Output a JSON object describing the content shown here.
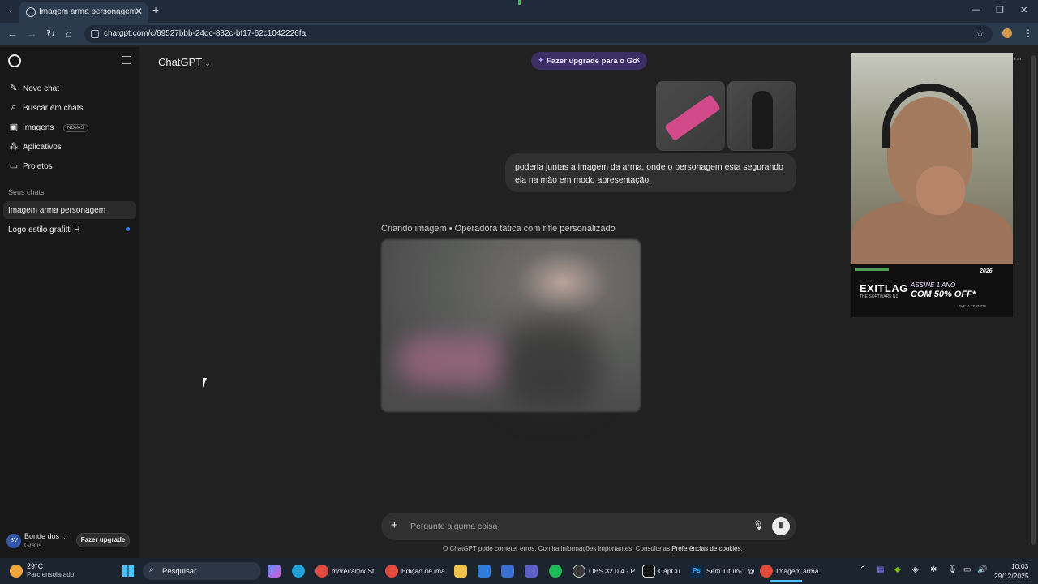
{
  "browser": {
    "tab_title": "Imagem arma personagem",
    "tab_close": "✕",
    "new_tab": "+",
    "tab_menu": "⌄",
    "url": "chatgpt.com/c/69527bbb-24dc-832c-bf17-62c1042226fa",
    "back": "←",
    "forward": "→",
    "reload": "↻",
    "home": "⌂",
    "star": "☆",
    "menu": "⋮",
    "minimize": "—",
    "maximize": "❐",
    "close": "✕"
  },
  "sidebar": {
    "nav": [
      {
        "label": "Novo chat",
        "icon": "✎",
        "icon_name": "new-chat-icon"
      },
      {
        "label": "Buscar em chats",
        "icon": "⌕",
        "icon_name": "search-icon"
      },
      {
        "label": "Imagens",
        "icon": "▣",
        "icon_name": "images-icon",
        "badge": "NOVAS"
      },
      {
        "label": "Aplicativos",
        "icon": "⁂",
        "icon_name": "apps-icon"
      },
      {
        "label": "Projetos",
        "icon": "▭",
        "icon_name": "folder-icon"
      }
    ],
    "section_title": "Seus chats",
    "chats": [
      {
        "label": "Imagem arma personagem",
        "active": true
      },
      {
        "label": "Logo estilo grafitti H",
        "unread": true
      }
    ],
    "user": {
      "initials": "BV",
      "name": "Bonde dos ...",
      "plan": "Grátis",
      "upgrade_label": "Fazer upgrade"
    }
  },
  "header": {
    "model": "ChatGPT",
    "model_chevron": "⌄",
    "upgrade_pill": "Fazer upgrade para o Go",
    "upgrade_close": "✕",
    "upgrade_icon": "✦",
    "more": "⋯"
  },
  "conversation": {
    "user_message": "poderia juntas a imagem da arma, onde o personagem esta segurando ela na mão em modo apresentação.",
    "generation_status": "Criando imagem • Operadora tática com rifle personalizado"
  },
  "composer": {
    "plus": "+",
    "placeholder": "Pergunte alguma coisa",
    "mic": "🎙",
    "voice": "⦀"
  },
  "disclaimer": {
    "text": "O ChatGPT pode cometer erros. Confira informações importantes. Consulte as ",
    "link": "Preferências de cookies",
    "end": "."
  },
  "overlay_ad": {
    "year": "2026",
    "brand": "EXITLAG",
    "sub": "THE SOFTWARE N1",
    "line1": "ASSINE 1 ANO",
    "line2": "COM 50% OFF*",
    "line3": "*VEJA TERMOS"
  },
  "taskbar": {
    "weather_temp": "29°C",
    "weather_desc": "Parc ensolarado",
    "search_label": "Pesquisar",
    "search_icon": "⌕",
    "apps": [
      {
        "label": "moreiramix St",
        "color": "#e04b3b"
      },
      {
        "label": "Edição de ima",
        "color": "#e04b3b"
      },
      {
        "label": "OBS 32.0.4 - P",
        "color": "#3a3a3a"
      },
      {
        "label": "CapCu",
        "color": "#111111"
      },
      {
        "label": "Sem Título-1 @",
        "color": "#0b2a4a"
      },
      {
        "label": "Imagem arma",
        "color": "#e04b3b"
      }
    ],
    "time": "10:03",
    "date": "29/12/2025"
  }
}
